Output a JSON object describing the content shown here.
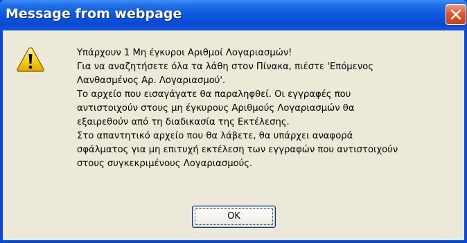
{
  "window": {
    "title": "Message from webpage"
  },
  "icons": {
    "warning": "warning-icon",
    "close": "close-icon"
  },
  "message": {
    "lines": [
      "Υπάρχουν 1 Μη έγκυροι Αριθμοί Λογαριασμών!",
      "Για να αναζητήσετε όλα τα λάθη στον Πίνακα, πιέστε 'Επόμενος",
      "Λανθασμένος Αρ. Λογαριασμού'.",
      "Το αρχείο που εισαγάγατε θα παραληφθεί. Οι εγγραφές που",
      "αντιστοιχούν στους μη έγκυρους Αριθμούς Λογαριασμών θα",
      "εξαιρεθούν από τη διαδικασία της Εκτέλεσης.",
      "Στο απαντητικό αρχείο που θα λάβετε, θα υπάρχει αναφορά",
      "σφάλματος για μη επιτυχή εκτέλεση των εγγραφών που αντιστοιχούν",
      "στους συγκεκριμένους Λογαριασμούς."
    ]
  },
  "buttons": {
    "ok_label": "OK"
  },
  "colors": {
    "titlebar": "#0a4ad2",
    "client": "#ece9d8",
    "close": "#e2562d",
    "warning_fill": "#f7d21e"
  }
}
